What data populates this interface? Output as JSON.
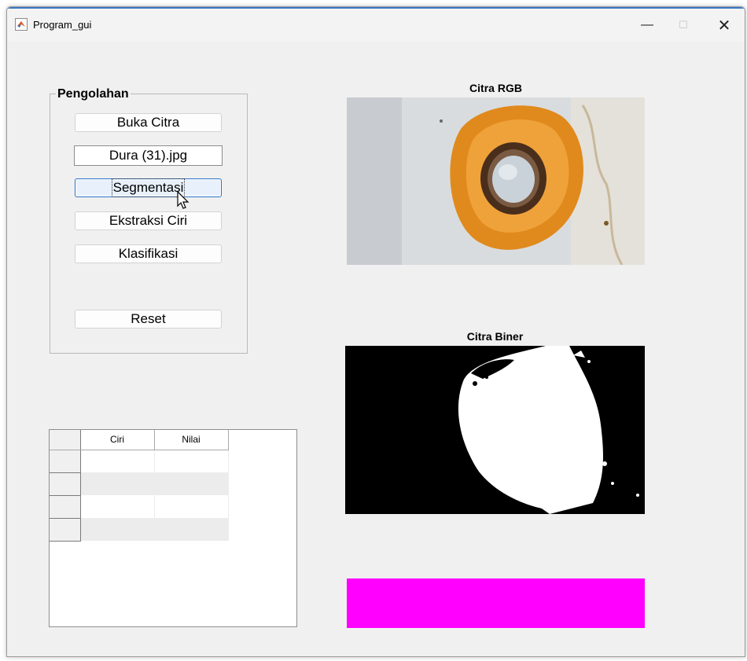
{
  "window": {
    "title": "Program_gui",
    "minimize_glyph": "—",
    "maximize_glyph": "☐",
    "close_glyph": "✕"
  },
  "panel": {
    "title": "Pengolahan",
    "buttons": {
      "open_image": "Buka Citra",
      "segmentation": "Segmentasi",
      "feature_extraction": "Ekstraksi Ciri",
      "classification": "Klasifikasi",
      "reset": "Reset"
    },
    "file_name": "Dura (31).jpg"
  },
  "images": {
    "rgb_caption": "Citra RGB",
    "binary_caption": "Citra Biner"
  },
  "table": {
    "columns": [
      "Ciri",
      "Nilai"
    ],
    "rows": [
      [
        "",
        ""
      ],
      [
        "",
        ""
      ],
      [
        "",
        ""
      ],
      [
        "",
        ""
      ]
    ]
  },
  "colors": {
    "result_bar": "#ff00ff",
    "title_accent": "#3a78c8",
    "focus_border": "#2a74c9"
  },
  "icons": {
    "app": "matlab-icon",
    "cursor": "mouse-pointer-icon"
  }
}
